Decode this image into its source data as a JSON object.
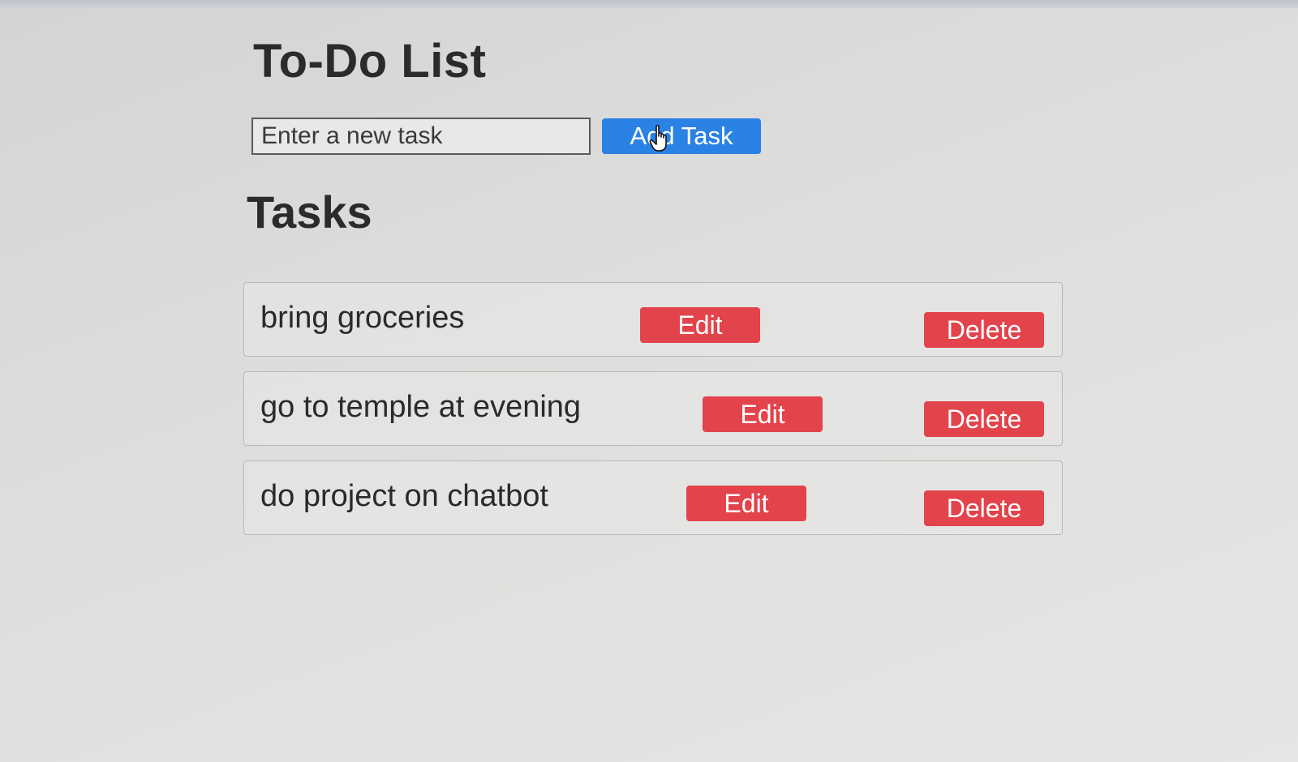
{
  "header": {
    "title": "To-Do List"
  },
  "add_form": {
    "input_placeholder": "Enter a new task",
    "input_value": "",
    "button_label": "Add Task",
    "button_color": "#2a82e4"
  },
  "tasks_section": {
    "title": "Tasks",
    "items": [
      {
        "text": "bring groceries",
        "edit_label": "Edit",
        "delete_label": "Delete"
      },
      {
        "text": "go to temple at evening",
        "edit_label": "Edit",
        "delete_label": "Delete"
      },
      {
        "text": "do project on chatbot",
        "edit_label": "Edit",
        "delete_label": "Delete"
      }
    ]
  },
  "colors": {
    "edit_button": "#e3434b",
    "delete_button": "#e3434b"
  },
  "icons": {
    "cursor": "hand-pointer-icon"
  }
}
